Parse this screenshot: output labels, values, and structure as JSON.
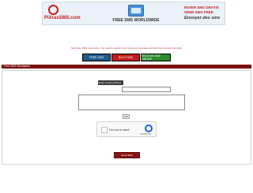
{
  "banner": {
    "logo_text": "PiXrasSMS.com",
    "center_caption": "FREE SMS WORLDWIDE",
    "right_line1": "INVIER SMS GRATIS",
    "right_line2": "SEND SMS FREE",
    "right_line3": "Envoyer des sms"
  },
  "intro_text": "Send free SMS now online, You need to register, just write your message and send them to any Friend(s).",
  "nav": {
    "free_sms": "FREE SMS",
    "bulk_sms": "BULK SMS",
    "receive_sms": "RECEIVE SMS ONLINE"
  },
  "section_title": "Free SMS Worldwide",
  "form": {
    "phone_label": "Enter Country Phone",
    "phone_value": "",
    "message_value": "",
    "char_counter": "160",
    "captcha_label": "I'm not a robot",
    "captcha_brand": "reCAPTCHA",
    "submit_label": "Send SMS"
  },
  "colors": {
    "banner_bg": "#eaf1f8",
    "brand_red": "#c71f1f",
    "section_bar": "#7a1010",
    "nav_free": "#1f5a8a",
    "nav_bulk": "#c01c1c",
    "nav_receive": "#2c8a2c"
  }
}
